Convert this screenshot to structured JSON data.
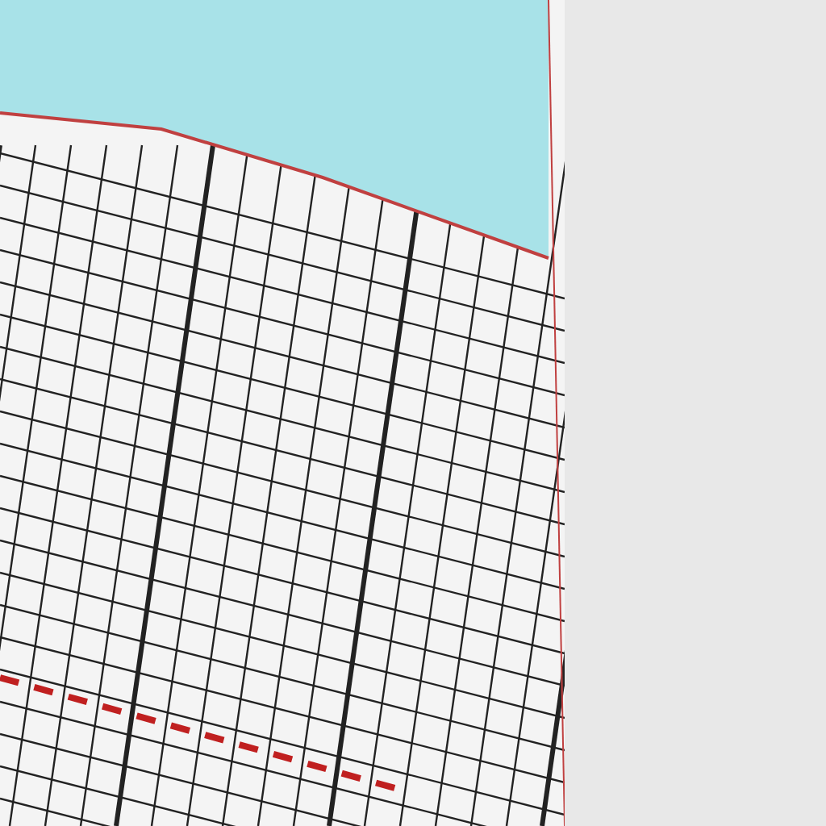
{
  "panels": [
    {
      "kind": "map"
    }
  ]
}
